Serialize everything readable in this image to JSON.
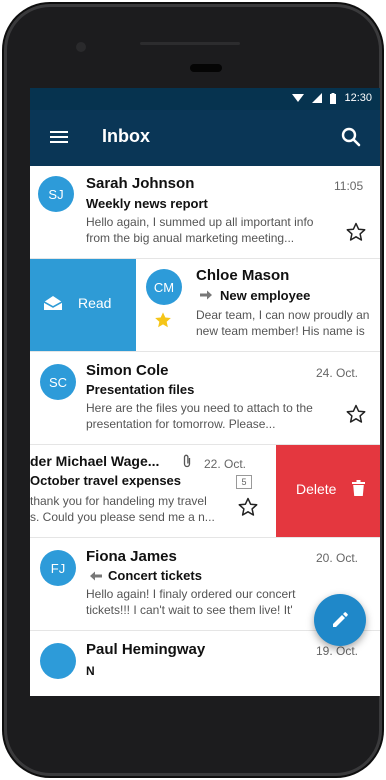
{
  "status_bar": {
    "time": "12:30"
  },
  "header": {
    "title": "Inbox"
  },
  "actions": {
    "read_label": "Read",
    "delete_label": "Delete"
  },
  "emails": [
    {
      "initials": "SJ",
      "sender": "Sarah Johnson",
      "time": "11:05",
      "subject": "Weekly news report",
      "preview_line1": "Hello again, I summed up all important info",
      "preview_line2": "from the big anual marketing meeting..."
    },
    {
      "initials": "CM",
      "sender": "Chloe Mason",
      "subject": "New employee",
      "preview_line1": "Dear team, I can now proudly an",
      "preview_line2": "new team member! His name is"
    },
    {
      "initials": "SC",
      "sender": "Simon Cole",
      "time": "24. Oct.",
      "subject": "Presentation files",
      "preview_line1": "Here are the files you need to attach to the",
      "preview_line2": "presentation for tomorrow. Please..."
    },
    {
      "sender": "der Michael Wage...",
      "time": "22. Oct.",
      "count": "5",
      "subject": "October travel expenses",
      "preview_line1": "thank you for handeling my travel",
      "preview_line2": "s. Could you please send me a n..."
    },
    {
      "initials": "FJ",
      "sender": "Fiona James",
      "time": "20. Oct.",
      "subject": "Concert tickets",
      "preview_line1": "Hello again! I finaly ordered our concert",
      "preview_line2": "tickets!!! I can't wait to see them live! It'"
    },
    {
      "sender": "Paul Hemingway",
      "time": "19. Oct.",
      "preview_line1": "N"
    }
  ],
  "colors": {
    "appbar": "#0a3656",
    "avatar": "#2d9bd9",
    "read_action": "#2e9bd6",
    "delete_action": "#e4373f",
    "star": "#f5c518"
  }
}
